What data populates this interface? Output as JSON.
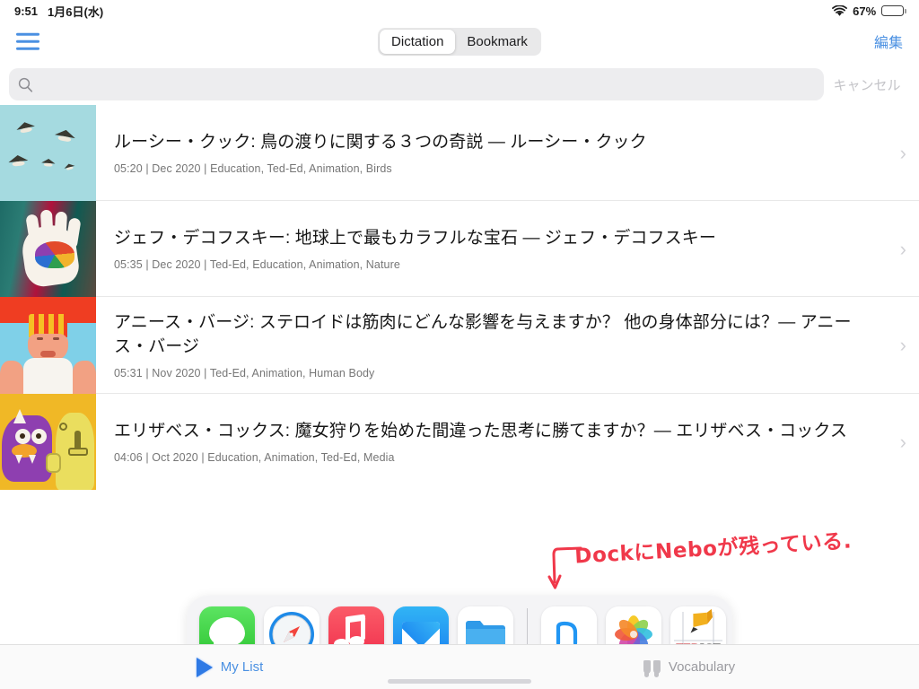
{
  "statusbar": {
    "time": "9:51",
    "date": "1月6日(水)",
    "battery_percent": "67%",
    "wifi_icon": "wifi-icon",
    "battery_icon": "battery-icon"
  },
  "navbar": {
    "menu_icon": "hamburger-menu-icon",
    "segments": [
      {
        "label": "Dictation",
        "selected": true
      },
      {
        "label": "Bookmark",
        "selected": false
      }
    ],
    "edit_label": "編集"
  },
  "search": {
    "icon": "search-icon",
    "value": "",
    "placeholder": "",
    "cancel_label": "キャンセル"
  },
  "list": {
    "disclosure_icon": "chevron-right-icon",
    "items": [
      {
        "title": "ルーシー・クック: 鳥の渡りに関する３つの奇説 ― ルーシー・クック",
        "meta": "05:20 | Dec 2020 | Education, Ted-Ed, Animation, Birds",
        "duration": "05:20",
        "date": "Dec 2020",
        "tags": "Education, Ted-Ed, Animation, Birds",
        "thumbnail": "birds-in-sky-thumbnail"
      },
      {
        "title": "ジェフ・デコフスキー: 地球上で最もカラフルな宝石 ― ジェフ・デコフスキー",
        "meta": "05:35 | Dec 2020 | Ted-Ed, Education, Animation, Nature",
        "duration": "05:35",
        "date": "Dec 2020",
        "tags": "Ted-Ed, Education, Animation, Nature",
        "thumbnail": "hand-holding-gem-thumbnail"
      },
      {
        "title": "アニース・バージ: ステロイドは筋肉にどんな影響を与えますか？ 他の身体部分には？― アニース・バージ",
        "meta": "05:31 | Nov 2020 | Ted-Ed, Animation, Human Body",
        "duration": "05:31",
        "date": "Nov 2020",
        "tags": "Ted-Ed, Animation, Human Body",
        "thumbnail": "muscular-figure-thumbnail"
      },
      {
        "title": "エリザベス・コックス: 魔女狩りを始めた間違った思考に勝てますか？― エリザベス・コックス",
        "meta": "04:06 | Oct 2020 | Education, Animation, Ted-Ed, Media",
        "duration": "04:06",
        "date": "Oct 2020",
        "tags": "Education, Animation, Ted-Ed, Media",
        "thumbnail": "monster-cartoon-thumbnail"
      }
    ]
  },
  "annotation": {
    "text": "DockにNeboが残っている.",
    "color": "#f0384a",
    "arrow_icon": "hand-drawn-arrow-icon"
  },
  "dock": {
    "icons": [
      {
        "name": "messages-app-icon",
        "label": "Messages"
      },
      {
        "name": "safari-app-icon",
        "label": "Safari"
      },
      {
        "name": "music-app-icon",
        "label": "Music"
      },
      {
        "name": "mail-app-icon",
        "label": "Mail"
      },
      {
        "name": "files-app-icon",
        "label": "Files"
      },
      {
        "name": "nebo-app-icon",
        "label": "Nebo"
      },
      {
        "name": "photos-app-icon",
        "label": "Photos"
      },
      {
        "name": "tedict-app-icon",
        "label": "TEDICT"
      }
    ],
    "tedict_label": "TEDICT",
    "nebo_glyph": "n"
  },
  "tabbar": {
    "tabs": [
      {
        "label": "My List",
        "icon": "play-triangle-icon",
        "active": true
      },
      {
        "label": "Vocabulary",
        "icon": "quote-marks-icon",
        "active": false
      }
    ]
  },
  "colors": {
    "accent": "#4a90e2",
    "annotation_red": "#f0384a",
    "inactive_gray": "#9a9a9f"
  }
}
